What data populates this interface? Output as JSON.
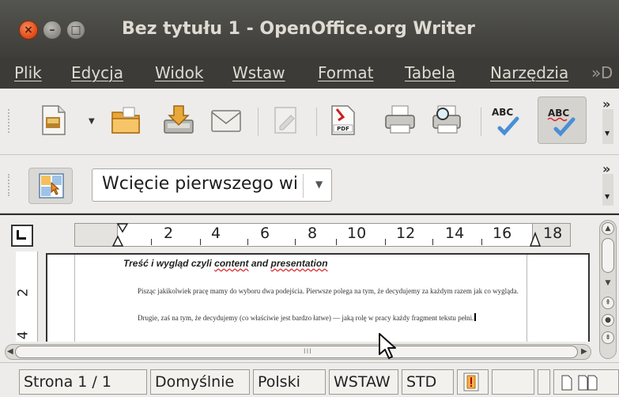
{
  "window": {
    "title": "Bez tytułu 1 - OpenOffice.org Writer",
    "close_symbol": "×",
    "minimize_symbol": "–",
    "maximize_symbol": "□"
  },
  "menu": {
    "items": [
      {
        "label": "Plik"
      },
      {
        "label": "Edycja"
      },
      {
        "label": "Widok"
      },
      {
        "label": "Wstaw"
      },
      {
        "label": "Format"
      },
      {
        "label": "Tabela"
      },
      {
        "label": "Narzędzia"
      }
    ],
    "overflow": "»D"
  },
  "toolbar_standard": {
    "icons": [
      "new-document-icon",
      "open-folder-icon",
      "save-icon",
      "email-icon",
      "edit-file-icon",
      "export-pdf-icon",
      "print-icon",
      "print-preview-icon",
      "spellcheck-icon",
      "autospellcheck-icon"
    ],
    "pdf_label": "PDF",
    "abc_label": "ABC",
    "overflow": "»"
  },
  "toolbar_formatting": {
    "paragraph_style": "Wcięcie pierwszego wiersza",
    "overflow": "»"
  },
  "ruler": {
    "numbers": [
      "2",
      "4",
      "6",
      "8",
      "10",
      "12",
      "14",
      "16",
      "18"
    ]
  },
  "vertical_ruler": {
    "numbers": [
      "2",
      "4"
    ]
  },
  "document": {
    "heading_before": "Treść i wygląd czyli ",
    "heading_content": "content",
    "heading_and": " and ",
    "heading_presentation": "presentation",
    "paragraph1": "Pisząc jakikolwiek pracę mamy do wyboru dwa podejścia. Pierwsze polega na tym, że decydujemy za każdym razem jak co wygląda.",
    "paragraph2": "Drugie, zaś na tym, że decydujemy (co właściwie jest bardzo łatwe) — jaką rolę w pracy każdy fragment tekstu pełni."
  },
  "hscroll": {
    "grip": "III"
  },
  "statusbar": {
    "page": "Strona  1 / 1",
    "style": "Domyślnie",
    "language": "Polski",
    "insert_mode": "WSTAW",
    "selection_mode": "STD"
  }
}
